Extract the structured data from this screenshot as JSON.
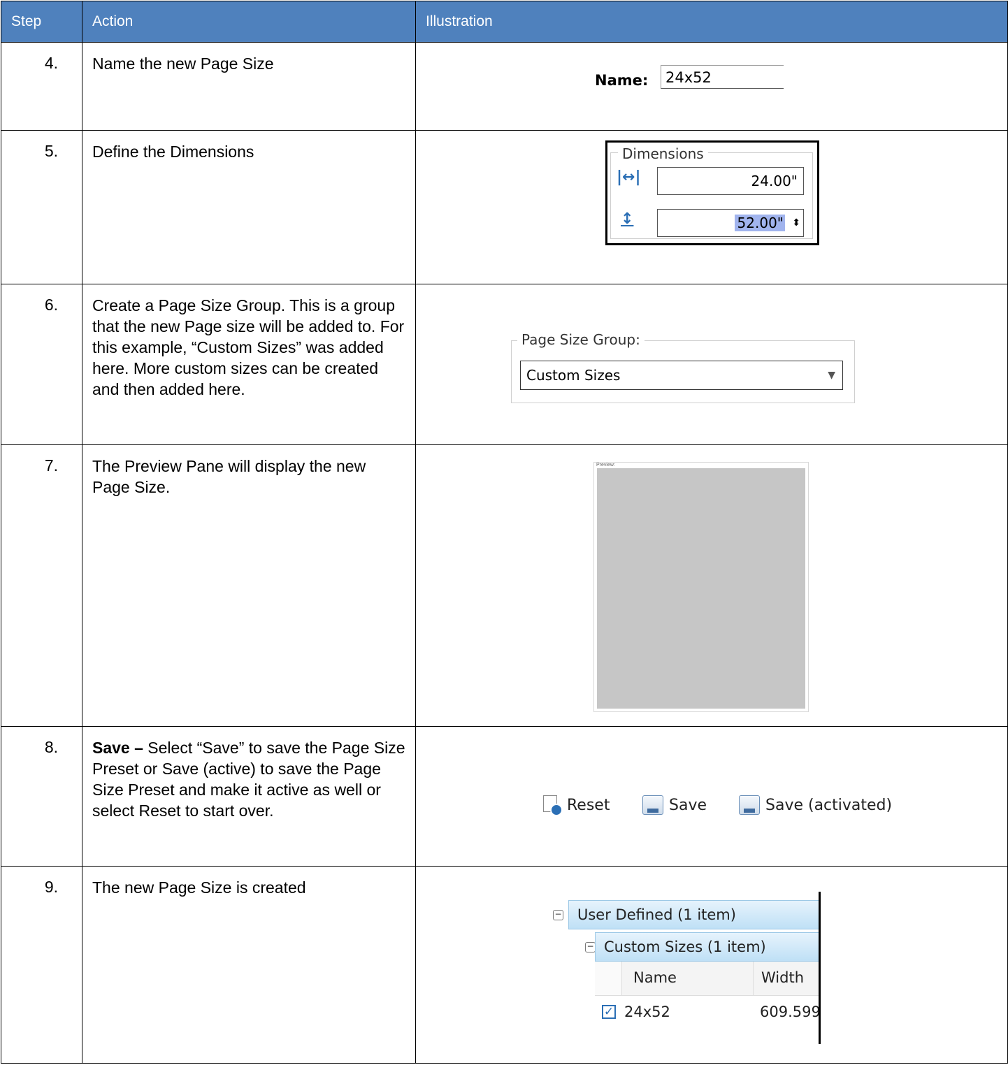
{
  "header": {
    "step": "Step",
    "action": "Action",
    "illustration": "Illustration"
  },
  "rows": [
    {
      "step": "4.",
      "action": "Name the new Page Size"
    },
    {
      "step": "5.",
      "action": "Define the Dimensions"
    },
    {
      "step": "6.",
      "action": "Create a Page Size Group. This is a group that the new Page size will be added to. For this example, “Custom Sizes” was added here. More custom sizes can be created and then added here."
    },
    {
      "step": "7.",
      "action": "The Preview Pane will display the new Page Size."
    },
    {
      "step": "8.",
      "action_bold": "Save –",
      "action": " Select “Save” to save the Page Size Preset or Save (active) to save the Page Size Preset and make it active as well or select Reset to start over."
    },
    {
      "step": "9.",
      "action": "The new Page Size is created"
    }
  ],
  "name_field": {
    "label": "Name:",
    "value": "24x52"
  },
  "dimensions": {
    "legend": "Dimensions",
    "width": "24.00\"",
    "height": "52.00\""
  },
  "page_size_group": {
    "legend": "Page Size Group:",
    "selected": "Custom Sizes"
  },
  "preview": {
    "label": "Preview:"
  },
  "buttons": {
    "reset": "Reset",
    "save": "Save",
    "save_activated": "Save (activated)"
  },
  "tree": {
    "group1": "User Defined (1 item)",
    "group2": "Custom Sizes (1 item)",
    "col_name": "Name",
    "col_width": "Width",
    "row_name": "24x52",
    "row_width": "609.599"
  }
}
